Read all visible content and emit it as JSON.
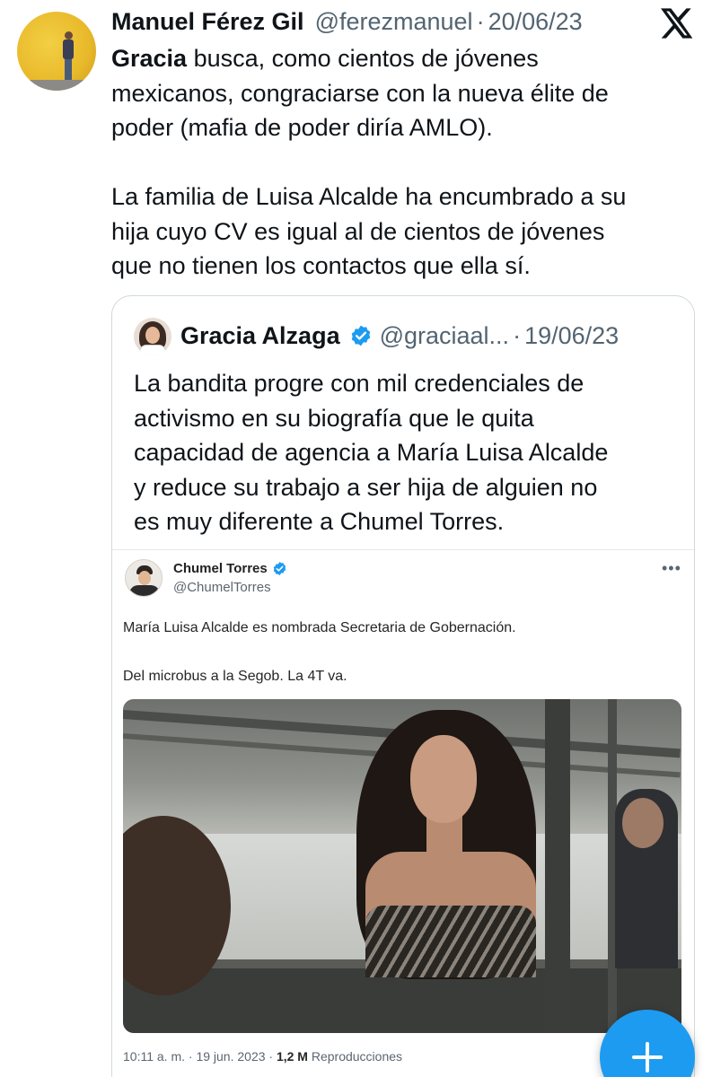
{
  "tweet": {
    "author_name": "Manuel Férez Gil",
    "author_handle": "@ferezmanuel",
    "separator": "·",
    "date": "20/06/23",
    "text_lines": [
      {
        "bold": "Gracia",
        "rest": " busca, como cientos de jóvenes"
      },
      {
        "rest": "mexicanos, congraciarse con la nueva élite de"
      },
      {
        "rest": "poder (mafia de poder diría AMLO)."
      },
      {
        "rest": ""
      },
      {
        "rest": "La familia de Luisa Alcalde ha encumbrado a su"
      },
      {
        "rest": "hija cuyo CV es igual al de cientos de jóvenes"
      },
      {
        "rest": "que no tienen los contactos que ella sí."
      }
    ]
  },
  "quote": {
    "author_name": "Gracia Alzaga",
    "author_handle": "@graciaal...",
    "separator": "·",
    "date": "19/06/23",
    "text_lines": [
      "La bandita progre con mil credenciales de",
      "activismo en su biografía que le quita",
      "capacidad de agencia a María Luisa Alcalde",
      "y reduce su trabajo a ser hija de alguien no",
      "es muy diferente a Chumel Torres."
    ]
  },
  "embedded": {
    "author_name": "Chumel Torres",
    "author_handle": "@ChumelTorres",
    "more": "•••",
    "text1": "María Luisa Alcalde es nombrada Secretaria de Gobernación.",
    "text2": "Del microbus a la Segob. La 4T va.",
    "footer_time": "10:11 a. m. · 19 jun. 2023 · ",
    "footer_views": "1,2 M",
    "footer_label": " Reproducciones"
  },
  "colors": {
    "accent": "#1d9bf0",
    "text_primary": "#0f1419",
    "text_secondary": "#536471",
    "border": "#cfd9de"
  },
  "icons": {
    "logo": "x-logo-icon",
    "verified": "verified-badge-icon",
    "compose": "plus-icon"
  }
}
